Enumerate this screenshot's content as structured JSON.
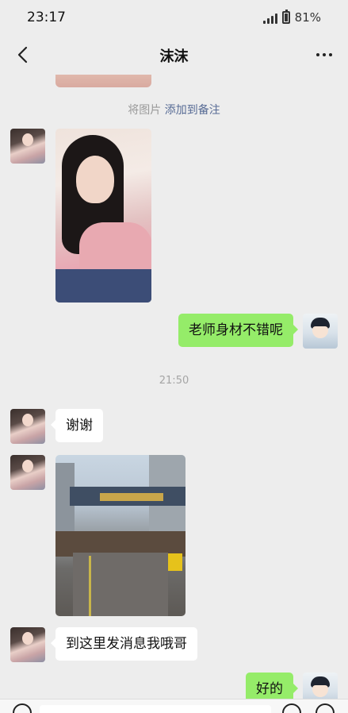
{
  "status_bar": {
    "time": "23:17",
    "battery": "81%",
    "icons": [
      "signal-icon",
      "battery-icon"
    ]
  },
  "nav": {
    "title": "沫沫",
    "back_icon": "chevron-left-icon",
    "more_icon": "more-dots-icon"
  },
  "messages": {
    "note_prefix": "将图片",
    "note_link": "添加到备注",
    "msg_compliment": "老师身材不错呢",
    "time_divider": "21:50",
    "msg_thanks": "谢谢",
    "msg_location": "到这里发消息我哦哥",
    "msg_ok": "好的"
  },
  "bottom_bar": {
    "icons": [
      "voice-icon",
      "emoji-icon",
      "plus-icon"
    ]
  }
}
